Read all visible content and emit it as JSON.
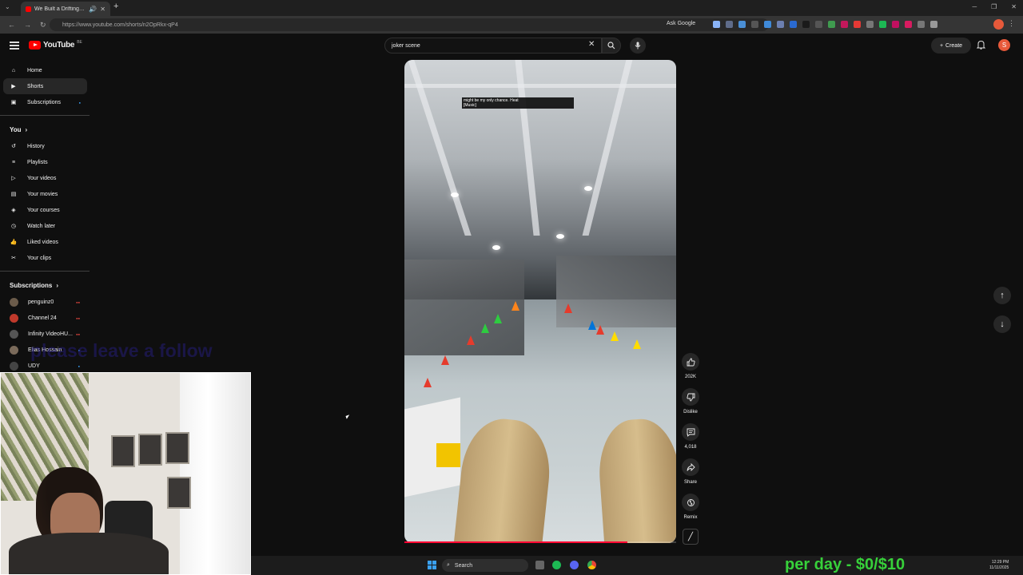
{
  "browser": {
    "tab_title": "We Built a Drifting Wheelch",
    "url": "https://www.youtube.com/shorts/n2OpRkx-qP4",
    "ask_google": "Ask Google"
  },
  "header": {
    "logo_text": "YouTube",
    "logo_country": "BE",
    "search_query": "joker scene",
    "create_label": "Create",
    "avatar_letter": "S"
  },
  "sidebar": {
    "main": [
      {
        "label": "Home",
        "icon": "home-icon"
      },
      {
        "label": "Shorts",
        "icon": "shorts-icon"
      },
      {
        "label": "Subscriptions",
        "icon": "subscriptions-icon"
      }
    ],
    "you_heading": "You",
    "you": [
      {
        "label": "History",
        "icon": "history-icon"
      },
      {
        "label": "Playlists",
        "icon": "playlists-icon"
      },
      {
        "label": "Your videos",
        "icon": "your-videos-icon"
      },
      {
        "label": "Your movies",
        "icon": "movies-icon"
      },
      {
        "label": "Your courses",
        "icon": "courses-icon"
      },
      {
        "label": "Watch later",
        "icon": "clock-icon"
      },
      {
        "label": "Liked videos",
        "icon": "thumbs-up-icon"
      },
      {
        "label": "Your clips",
        "icon": "scissors-icon"
      }
    ],
    "subs_heading": "Subscriptions",
    "subs": [
      {
        "label": "penguinz0",
        "color": "#6b5b4a"
      },
      {
        "label": "Channel 24",
        "color": "#c0392b"
      },
      {
        "label": "Infinity VideoHU...",
        "color": "#555555"
      },
      {
        "label": "Elias Hossain",
        "color": "#7a6a5a"
      },
      {
        "label": "UDY",
        "color": "#444444"
      }
    ]
  },
  "overlay_text": "please leave a follow",
  "short": {
    "caption_line1": "might be my only chance. Heat",
    "caption_line2": "[Music]",
    "progress_fraction": 0.82
  },
  "actions": {
    "like_count": "202K",
    "dislike_label": "Dislike",
    "comments_count": "4,018",
    "share_label": "Share",
    "remix_label": "Remix"
  },
  "taskbar": {
    "search_label": "Search",
    "stream_goal": "per day - $0/$10",
    "time": "12:29 PM",
    "date": "11/11/2025"
  },
  "colors": {
    "brand_red": "#ff0000",
    "progress_red": "#ff0033",
    "goal_green": "#37d13a"
  }
}
